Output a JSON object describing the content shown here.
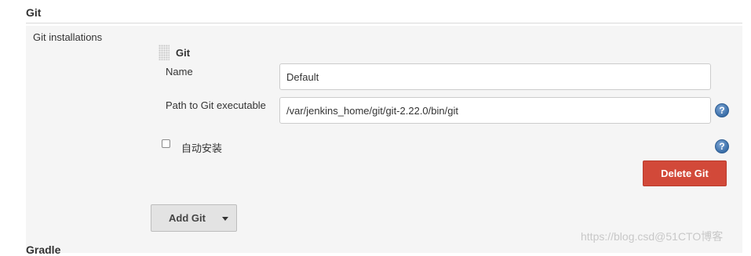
{
  "section": {
    "title": "Git",
    "next_title": "Gradle"
  },
  "installations": {
    "label": "Git installations",
    "item_title": "Git",
    "name_label": "Name",
    "name_value": "Default",
    "path_label": "Path to Git executable",
    "path_value": "/var/jenkins_home/git/git-2.22.0/bin/git",
    "auto_install_label": "自动安装",
    "auto_install_checked": false,
    "help_glyph": "?",
    "delete_label": "Delete Git",
    "add_label": "Add Git"
  },
  "icons": {
    "help": "help-icon",
    "drag": "drag-handle-icon",
    "caret": "caret-down-icon"
  },
  "colors": {
    "delete_button": "#d24939",
    "help_icon": "#3a6ea8",
    "panel_bg": "#f5f5f5"
  },
  "watermark": "https://blog.csd@51CTO博客"
}
